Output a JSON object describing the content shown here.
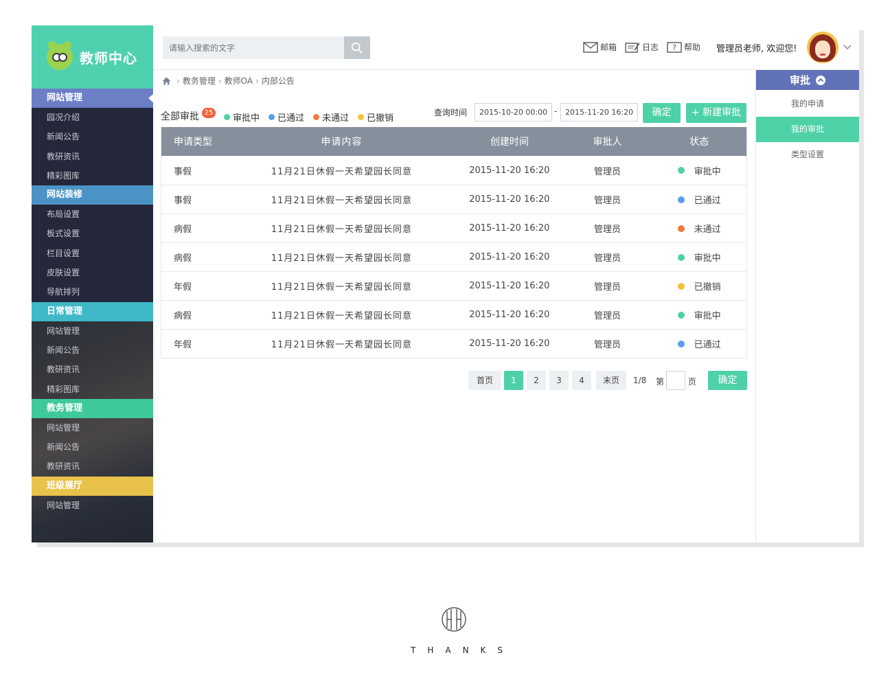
{
  "brand": {
    "name": "教师中心"
  },
  "sidebar": {
    "groups": [
      {
        "title": "网站管理",
        "color": "#6c7ec6",
        "active": true,
        "items": [
          "园况介绍",
          "新闻公告",
          "教研资讯",
          "精彩图库"
        ]
      },
      {
        "title": "网站装修",
        "color": "#4b93c7",
        "items": [
          "布局设置",
          "板式设置",
          "栏目设置",
          "皮肤设置",
          "导航排列"
        ]
      },
      {
        "title": "日常管理",
        "color": "#3fb8c8",
        "items": [
          "网站管理",
          "新闻公告",
          "教研资讯",
          "精彩图库"
        ]
      },
      {
        "title": "教务管理",
        "color": "#3fc99a",
        "items": [
          "网站管理",
          "新闻公告",
          "教研资讯"
        ]
      },
      {
        "title": "班级展厅",
        "color": "#e8c24a",
        "items": [
          "网站管理"
        ]
      }
    ]
  },
  "topbar": {
    "search_placeholder": "请输入搜索的文字",
    "links": {
      "mail": "邮箱",
      "log": "日志",
      "help": "帮助"
    },
    "welcome": "管理员老师, 欢迎您!"
  },
  "breadcrumb": [
    "教务管理",
    "教师OA",
    "内部公告"
  ],
  "filters": {
    "all_label": "全部审批",
    "all_count": "25",
    "legend": [
      {
        "label": "审批中",
        "color": "#4fd1a7"
      },
      {
        "label": "已通过",
        "color": "#5b9cf0"
      },
      {
        "label": "未通过",
        "color": "#f07a3c"
      },
      {
        "label": "已撤销",
        "color": "#f2c23a"
      }
    ],
    "query_label": "查询时间",
    "start_date": "2015-10-20  00:00",
    "date_sep": "-",
    "end_date": "2015-11-20  16:20",
    "confirm": "确定",
    "new_button": "+ 新建审批"
  },
  "table": {
    "headers": [
      "申请类型",
      "申请内容",
      "创建时间",
      "审批人",
      "状态"
    ],
    "rows": [
      {
        "type": "事假",
        "content": "11月21日休假一天希望园长同意",
        "time": "2015-11-20  16:20",
        "approver": "管理员",
        "status": "审批中",
        "color": "#4fd1a7"
      },
      {
        "type": "事假",
        "content": "11月21日休假一天希望园长同意",
        "time": "2015-11-20  16:20",
        "approver": "管理员",
        "status": "已通过",
        "color": "#5b9cf0"
      },
      {
        "type": "病假",
        "content": "11月21日休假一天希望园长同意",
        "time": "2015-11-20  16:20",
        "approver": "管理员",
        "status": "未通过",
        "color": "#f07a3c"
      },
      {
        "type": "病假",
        "content": "11月21日休假一天希望园长同意",
        "time": "2015-11-20  16:20",
        "approver": "管理员",
        "status": "审批中",
        "color": "#4fd1a7"
      },
      {
        "type": "年假",
        "content": "11月21日休假一天希望园长同意",
        "time": "2015-11-20  16:20",
        "approver": "管理员",
        "status": "已撤销",
        "color": "#f2c23a"
      },
      {
        "type": "病假",
        "content": "11月21日休假一天希望园长同意",
        "time": "2015-11-20  16:20",
        "approver": "管理员",
        "status": "审批中",
        "color": "#4fd1a7"
      },
      {
        "type": "年假",
        "content": "11月21日休假一天希望园长同意",
        "time": "2015-11-20  16:20",
        "approver": "管理员",
        "status": "已通过",
        "color": "#5b9cf0"
      }
    ]
  },
  "pagination": {
    "first": "首页",
    "pages": [
      "1",
      "2",
      "3",
      "4"
    ],
    "current": "1",
    "last": "末页",
    "info": "1/8",
    "goto_prefix": "第",
    "goto_suffix": "页",
    "confirm": "确定"
  },
  "right_panel": {
    "title": "审批",
    "items": [
      "我的申请",
      "我的审批",
      "类型设置"
    ],
    "active_index": 1
  },
  "footer": {
    "thanks": "THANKS"
  }
}
